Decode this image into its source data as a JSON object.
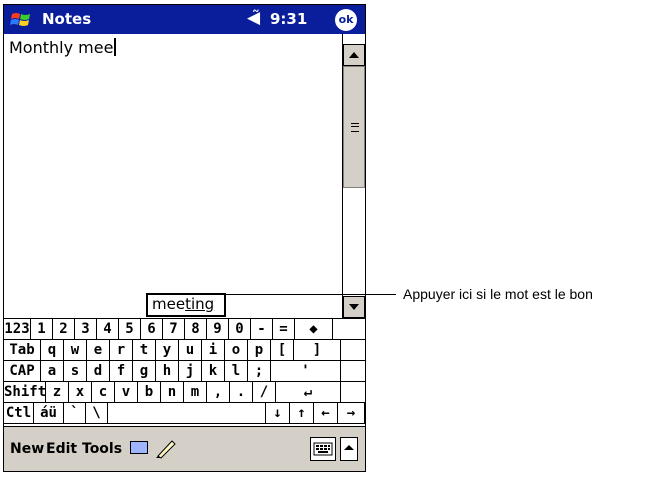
{
  "titlebar": {
    "app_title": "Notes",
    "clock": "9:31",
    "ok_label": "ok",
    "start_icon": "windows-flag-icon",
    "volume_icon": "speaker-icon"
  },
  "note": {
    "text": "Monthly mee"
  },
  "suggestion": {
    "typed": "mee",
    "completion": "ting"
  },
  "keyboard": {
    "rows": [
      [
        "123",
        "1",
        "2",
        "3",
        "4",
        "5",
        "6",
        "7",
        "8",
        "9",
        "0",
        "-",
        "=",
        "◆"
      ],
      [
        "Tab",
        "q",
        "w",
        "e",
        "r",
        "t",
        "y",
        "u",
        "i",
        "o",
        "p",
        "[",
        "]"
      ],
      [
        "CAP",
        "a",
        "s",
        "d",
        "f",
        "g",
        "h",
        "j",
        "k",
        "l",
        ";",
        "'"
      ],
      [
        "Shift",
        "z",
        "x",
        "c",
        "v",
        "b",
        "n",
        "m",
        ",",
        ".",
        "/",
        "↵"
      ],
      [
        "Ctl",
        "áü",
        "`",
        "\\",
        "",
        "↓",
        "↑",
        "←",
        "→"
      ]
    ]
  },
  "menubar": {
    "new_label": "New",
    "edit_label": "Edit",
    "tools_label": "Tools"
  },
  "callout": {
    "text": "Appuyer ici si le mot est le bon"
  },
  "colors": {
    "titlebar": "#0a1e9c",
    "menubar": "#d4d0c8"
  }
}
